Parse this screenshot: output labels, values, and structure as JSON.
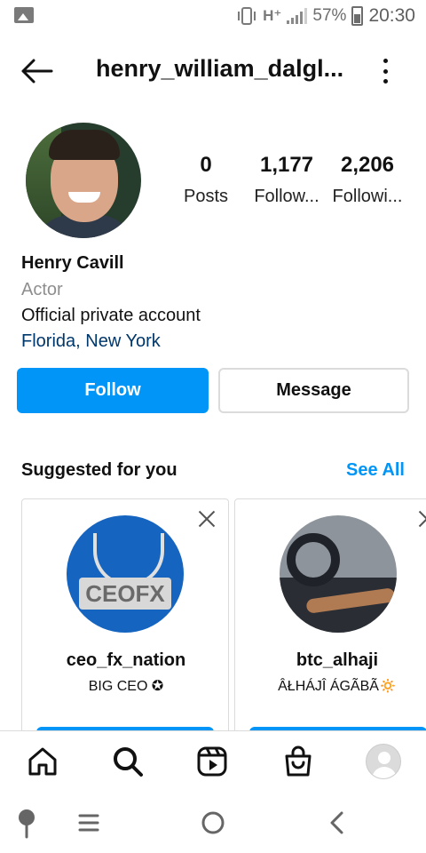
{
  "status_bar": {
    "network": "H⁺",
    "battery_percent": "57%",
    "time": "20:30",
    "icons": [
      "gallery-icon",
      "vibrate-icon",
      "signal-icon",
      "battery-charging-icon"
    ]
  },
  "header": {
    "username": "henry_william_dalgl...",
    "icons": [
      "back-arrow-icon",
      "more-options-icon"
    ]
  },
  "profile": {
    "avatar": "profile-photo",
    "stats": [
      {
        "value": "0",
        "label": "Posts"
      },
      {
        "value": "1,177",
        "label": "Follow..."
      },
      {
        "value": "2,206",
        "label": "Followi..."
      }
    ],
    "name": "Henry Cavill",
    "category": "Actor",
    "bio": "Official private account",
    "location": "Florida, New York"
  },
  "actions": {
    "follow_label": "Follow",
    "message_label": "Message"
  },
  "suggested": {
    "title": "Suggested for you",
    "see_all": "See All",
    "cards": [
      {
        "username": "ceo_fx_nation",
        "subtitle": "BIG CEO ✪",
        "avatar_text": "CEOFX"
      },
      {
        "username": "btc_alhaji",
        "subtitle": "ÂŁHÁJÎ ÁGÃBÃ🔅"
      }
    ]
  },
  "colors": {
    "accent_blue": "#0095f6",
    "location_link": "#00376b",
    "border": "#dbdbdb",
    "secondary_text": "#8e8e8e"
  },
  "bottom_nav": [
    "home-icon",
    "search-icon",
    "reels-icon",
    "shop-icon",
    "profile-avatar-icon"
  ],
  "system_nav": [
    "assistant-icon",
    "recents-icon",
    "home-circle-icon",
    "back-chevron-icon"
  ]
}
